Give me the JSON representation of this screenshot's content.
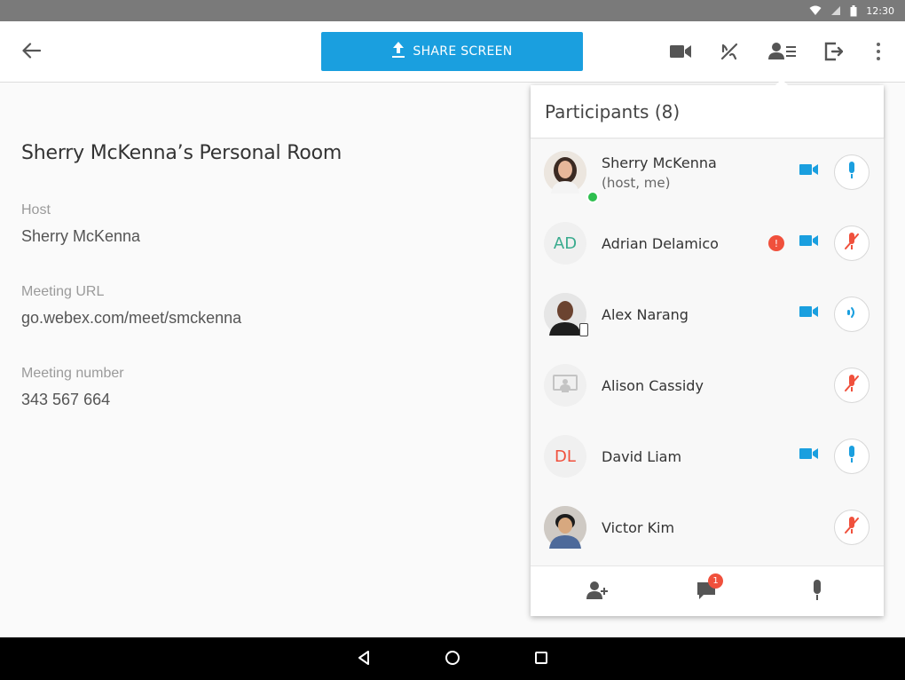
{
  "status_bar": {
    "time": "12:30",
    "icons": [
      "wifi-icon",
      "signal-icon",
      "battery-icon"
    ]
  },
  "toolbar": {
    "share_label": "SHARE SCREEN",
    "icons": [
      "back-arrow-icon",
      "video-camera-icon",
      "call-transfer-icon",
      "participants-list-icon",
      "leave-exit-icon",
      "more-vertical-icon"
    ]
  },
  "room": {
    "title": "Sherry McKenna’s Personal Room",
    "fields": [
      {
        "label": "Host",
        "value": "Sherry McKenna"
      },
      {
        "label": "Meeting URL",
        "value": "go.webex.com/meet/smckenna"
      },
      {
        "label": "Meeting number",
        "value": "343 567 664"
      }
    ]
  },
  "participants_panel": {
    "title": "Participants (8)",
    "participants": [
      {
        "name": "Sherry McKenna",
        "sub": "(host, me)",
        "avatar": "photo",
        "initials": "",
        "video": true,
        "mic": "on"
      },
      {
        "name": "Adrian Delamico",
        "sub": "",
        "avatar": "initials",
        "initials": "AD",
        "initials_color": "#3aab8e",
        "alert": "!",
        "video": true,
        "mic": "muted"
      },
      {
        "name": "Alex Narang",
        "sub": "",
        "avatar": "photo",
        "initials": "",
        "video": true,
        "mic": "speaking"
      },
      {
        "name": "Alison Cassidy",
        "sub": "",
        "avatar": "device",
        "initials": "",
        "video": false,
        "mic": "muted"
      },
      {
        "name": "David Liam",
        "sub": "",
        "avatar": "initials",
        "initials": "DL",
        "initials_color": "#f0503c",
        "video": true,
        "mic": "on"
      },
      {
        "name": "Victor Kim",
        "sub": "",
        "avatar": "photo",
        "initials": "",
        "video": false,
        "mic": "muted"
      }
    ],
    "footer": {
      "chat_badge": "1",
      "icons": [
        "add-participant-icon",
        "chat-icon",
        "mute-all-icon"
      ]
    }
  },
  "colors": {
    "accent": "#1a9fdf",
    "muted_red": "#f0503c",
    "status_bar": "#7a7a7a",
    "presence_green": "#2ebf4f"
  },
  "nav_bar": {
    "icons": [
      "back-triangle-icon",
      "home-circle-icon",
      "recents-square-icon"
    ]
  }
}
